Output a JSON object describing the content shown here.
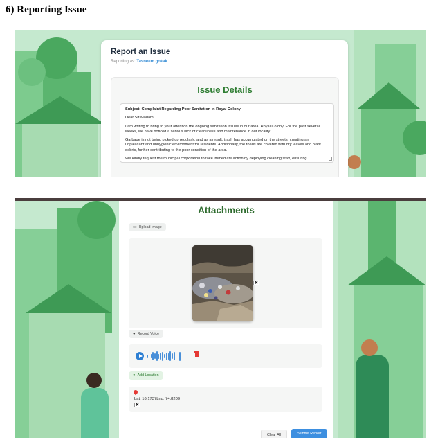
{
  "doc": {
    "heading": "6) Reporting  Issue"
  },
  "report": {
    "title": "Report an Issue",
    "reporting_as_label": "Reporting as:",
    "user_name": "Tasneem gokak",
    "details_title": "Issue Details",
    "letter": {
      "subject": "Subject: Complaint Regarding Poor Sanitation in Royal Colony",
      "salutation": "Dear Sir/Madam,",
      "para1": "I am writing to bring to your attention the ongoing sanitation issues in our area, Royal Colony. For the past several weeks, we have noticed a serious lack of cleanliness and maintenance in our locality.",
      "para2": "Garbage is not being picked up regularly, and as a result, trash has accumulated on the streets, creating an unpleasant and unhygienic environment for residents. Additionally, the roads are covered with dry leaves and plant debris, further contributing to the poor condition of the area.",
      "para3": "We kindly request the municipal corporation to take immediate action by deploying cleaning staff, ensuring"
    }
  },
  "attachments": {
    "title": "Attachments",
    "upload_image_label": "Upload Image",
    "remove_symbol": "✖",
    "record_voice_label": "Record Voice",
    "add_location_label": "Add Location",
    "lat_lng_text": "Lat: 16.1737Lng: 74.8209",
    "clear_all_label": "Clear All",
    "submit_label": "Submit Report"
  },
  "colors": {
    "accent_green": "#2e7d32",
    "primary_blue": "#3d8fe0",
    "danger_red": "#e53935",
    "background_green": "#c5e9cf"
  },
  "icons": [
    "image-icon",
    "microphone-icon",
    "location-pin-icon",
    "play-icon",
    "trash-icon",
    "close-icon"
  ]
}
